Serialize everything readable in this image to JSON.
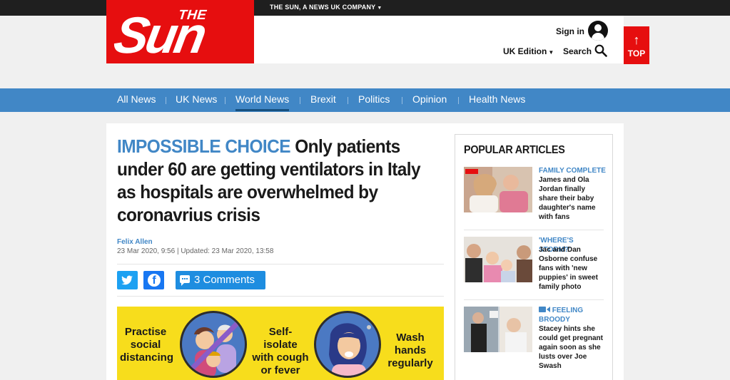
{
  "topbar": {
    "company": "THE SUN, A NEWS UK COMPANY"
  },
  "logo": {
    "the": "THE",
    "sun": "Sun"
  },
  "header": {
    "signin": "Sign in",
    "edition": "UK Edition",
    "search": "Search",
    "top": "TOP"
  },
  "nav": {
    "items": [
      {
        "label": "All News"
      },
      {
        "label": "UK News"
      },
      {
        "label": "World News"
      },
      {
        "label": "Brexit"
      },
      {
        "label": "Politics"
      },
      {
        "label": "Opinion"
      },
      {
        "label": "Health News"
      }
    ],
    "active_index": 2
  },
  "article": {
    "kicker": "IMPOSSIBLE CHOICE",
    "headline": "Only patients under 60 are getting ventilators in Italy as hospitals are overwhelmed by coronavrius crisis",
    "author": "Felix Allen",
    "dates": "23 Mar 2020, 9:56 | Updated: 23 Mar 2020, 13:58",
    "comments": "3 Comments"
  },
  "banner": {
    "item1": "Practise social distancing",
    "item2": "Self-isolate with cough or fever",
    "item3": "Wash hands regularly"
  },
  "sidebar": {
    "title": "POPULAR ARTICLES",
    "articles": [
      {
        "kicker": "FAMILY COMPLETE",
        "text": "James and Ola Jordan finally share their baby daughter's name with fans"
      },
      {
        "kicker": "'WHERE'S STORM?'",
        "text": "Jac and Dan Osborne confuse fans with 'new puppies' in sweet family photo"
      },
      {
        "kicker": "FEELING BROODY",
        "text": "Stacey hints she could get pregnant again soon as she lusts over Joe Swash"
      }
    ]
  },
  "colors": {
    "brand_red": "#e60e0f",
    "nav_blue": "#4187c6",
    "banner_yellow": "#f7dd1c"
  }
}
